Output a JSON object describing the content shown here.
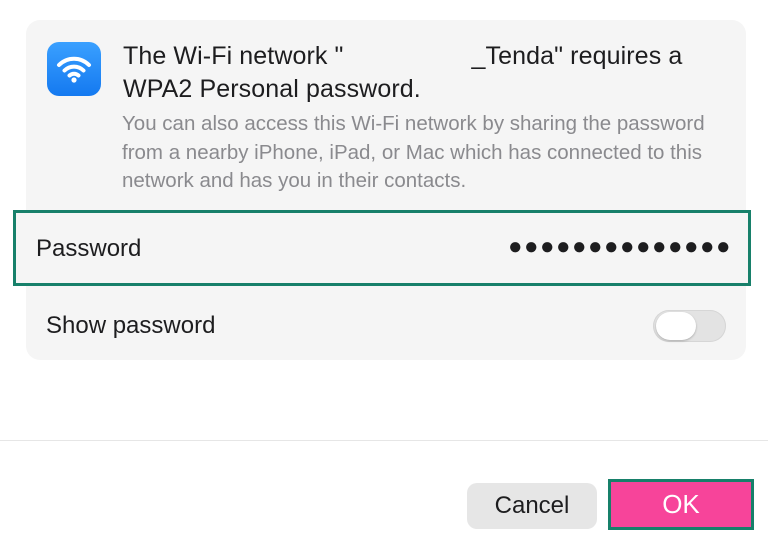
{
  "dialog": {
    "title_prefix": "The Wi-Fi network \"",
    "title_suffix": "_Tenda\" requires a WPA2 Personal password.",
    "description": "You can also access this Wi-Fi network by sharing the password from a nearby iPhone, iPad, or Mac which has connected to this network and has you in their contacts.",
    "icon": "wifi-icon",
    "accent_color": "#1479f0"
  },
  "password": {
    "label": "Password",
    "value_masked": "●●●●●●●●●●●●●●"
  },
  "show_password": {
    "label": "Show password",
    "enabled": false
  },
  "buttons": {
    "cancel_label": "Cancel",
    "ok_label": "OK",
    "ok_color": "#f7449a",
    "highlight_color": "#17806a"
  }
}
